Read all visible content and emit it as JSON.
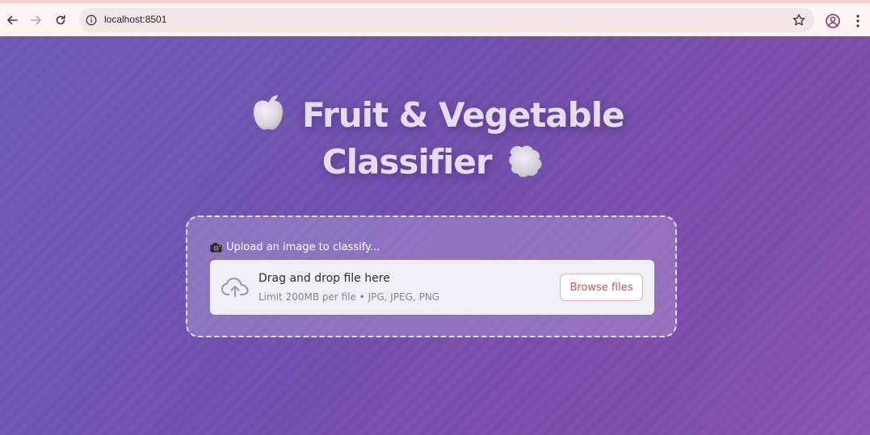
{
  "browser": {
    "url": "localhost:8501",
    "icons": {
      "back": "arrow-left-icon",
      "forward": "arrow-right-icon",
      "reload": "reload-icon",
      "site_info": "info-icon",
      "bookmark": "star-icon",
      "profile": "profile-icon",
      "menu": "kebab-menu-icon"
    }
  },
  "main": {
    "title_line1": "Fruit & Vegetable",
    "title_line2": "Classifier",
    "title_icons": [
      "apple-icon",
      "leafy-vegetable-icon"
    ],
    "upload": {
      "label": "Upload an image to classify...",
      "label_icon": "camera-icon",
      "dropzone_title": "Drag and drop file here",
      "dropzone_subtitle": "Limit 200MB per file • JPG, JPEG, PNG",
      "dropzone_icon": "cloud-upload-icon",
      "browse_label": "Browse files"
    }
  },
  "colors": {
    "background_start": "#6c5bb6",
    "background_end": "#8b56b5",
    "title_text": "#e5dcf0",
    "browse_text": "#d7504c"
  }
}
